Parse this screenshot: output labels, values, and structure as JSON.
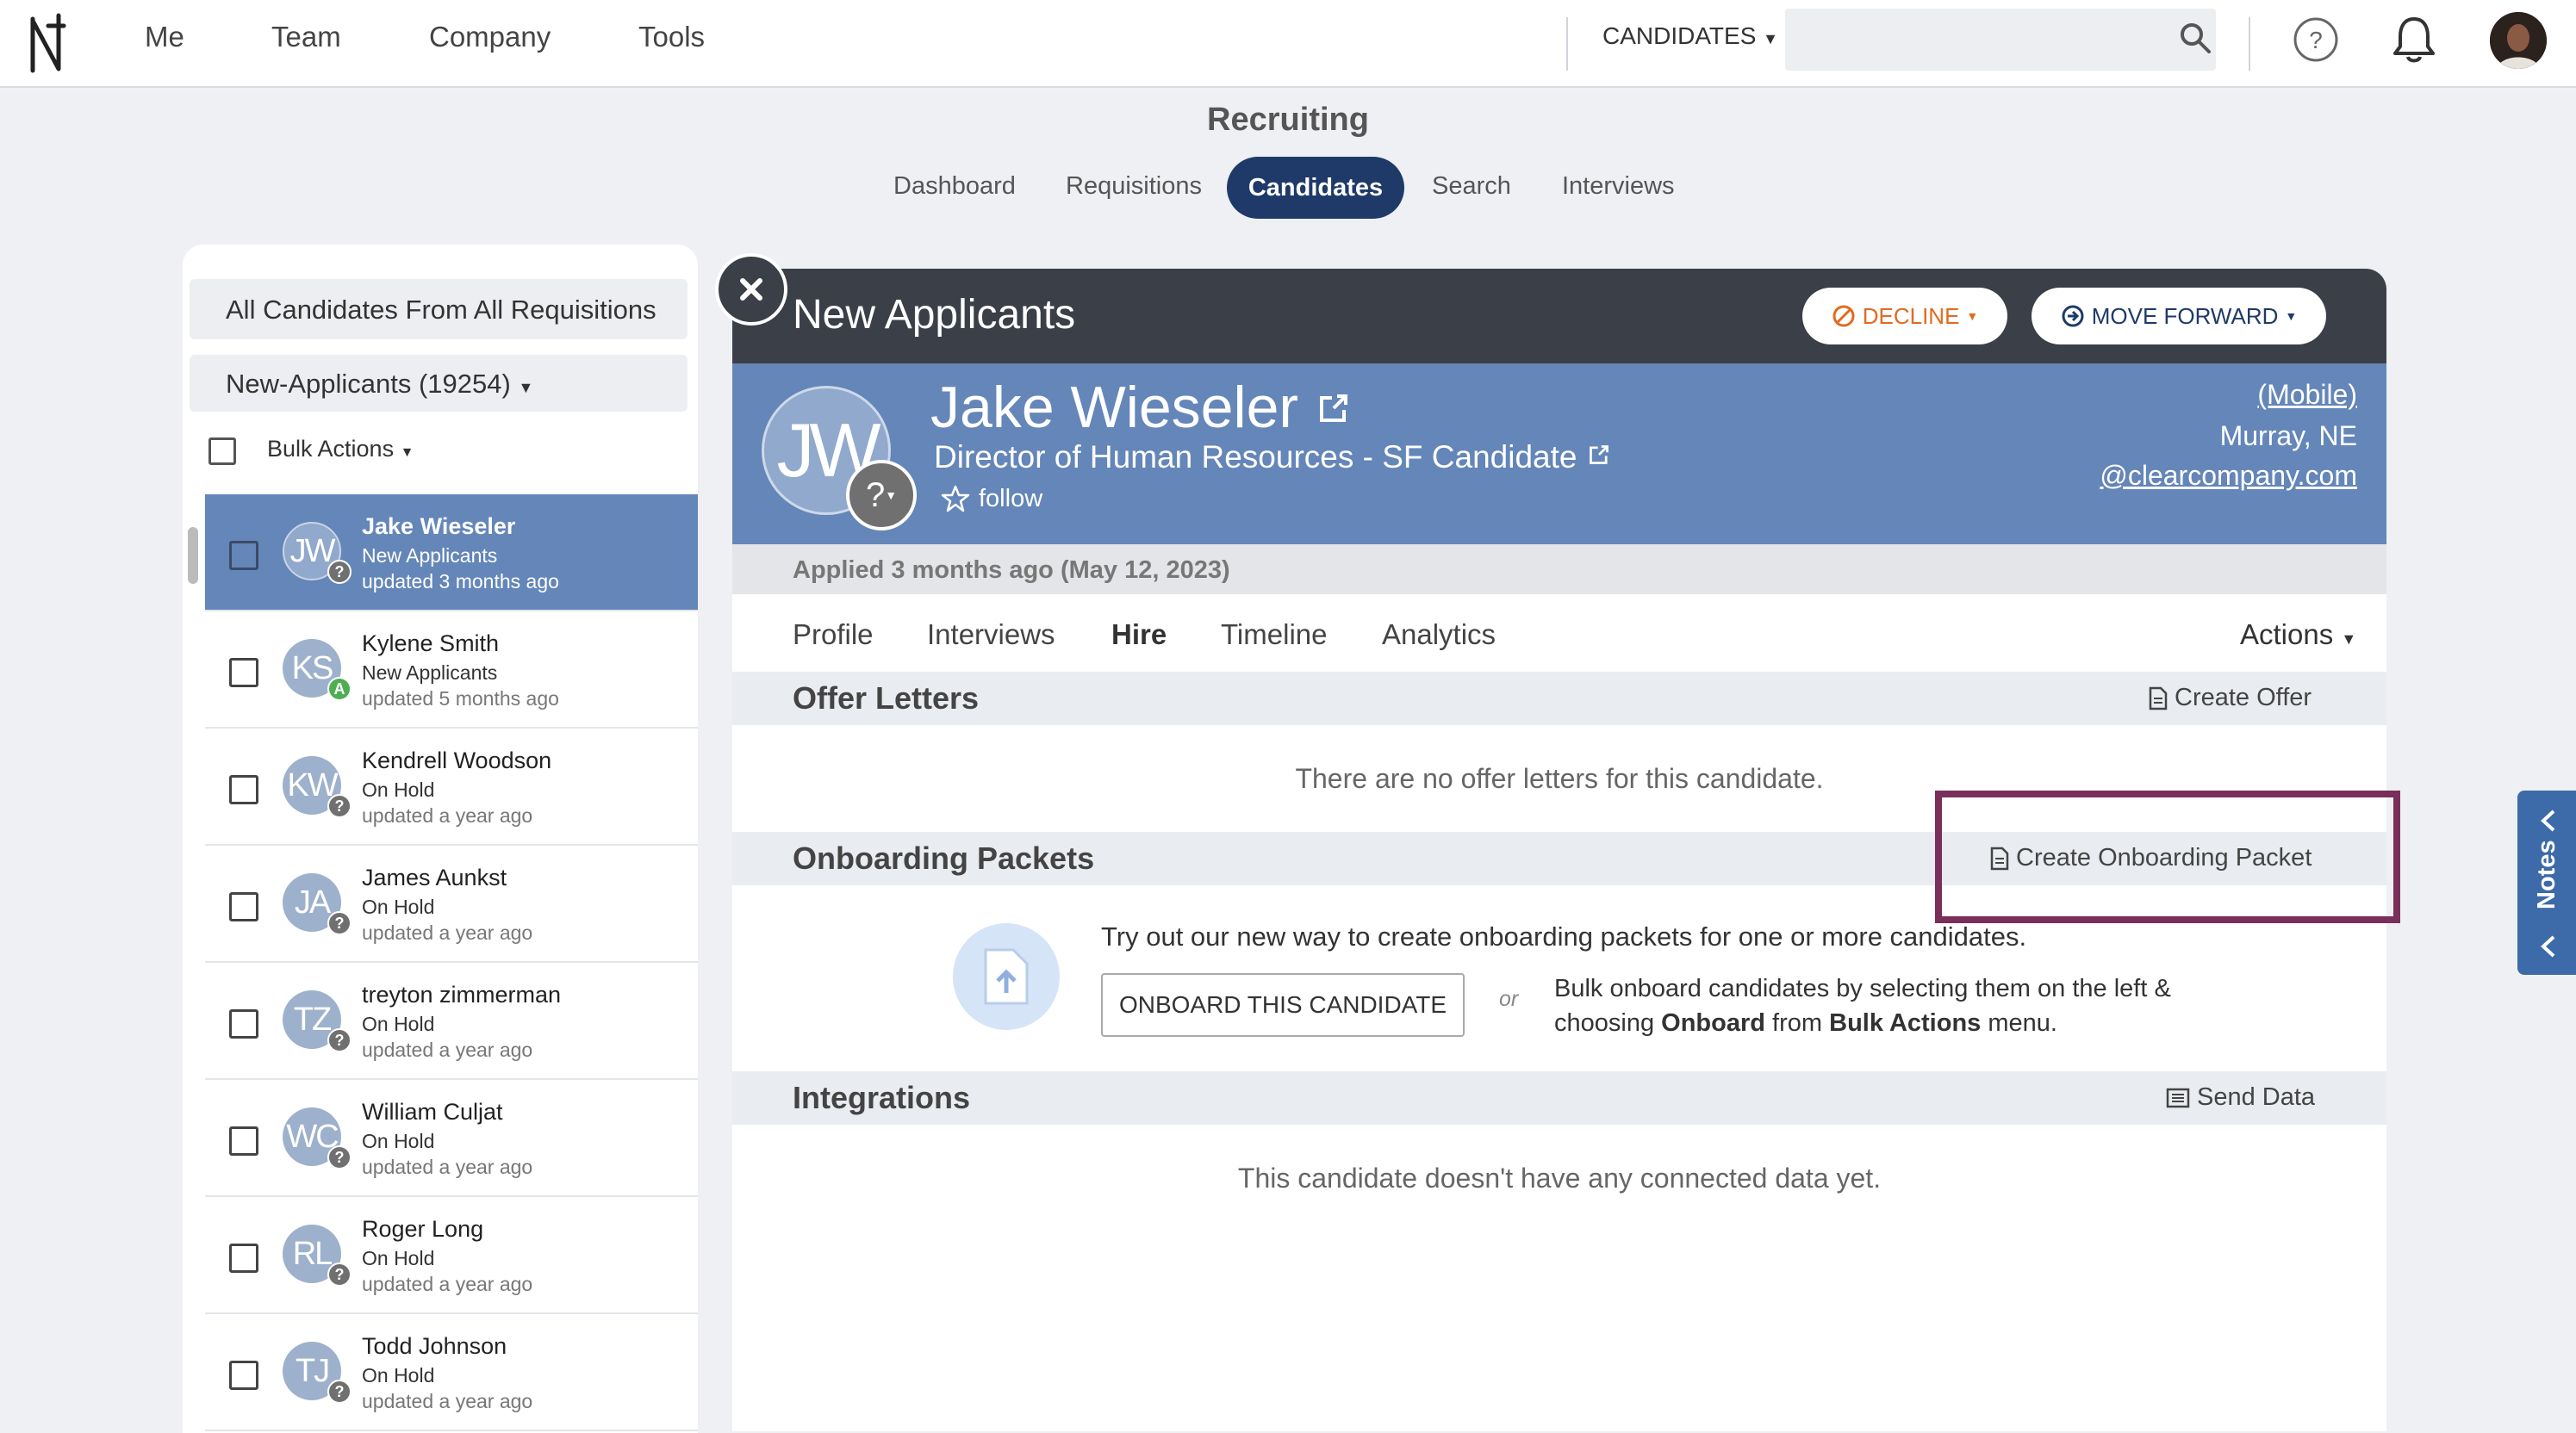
{
  "topnav": {
    "links": [
      "Me",
      "Team",
      "Company",
      "Tools"
    ],
    "search_scope": "CANDIDATES",
    "search_value": ""
  },
  "recruiting": {
    "title": "Recruiting",
    "tabs": [
      "Dashboard",
      "Requisitions",
      "Candidates",
      "Search",
      "Interviews"
    ],
    "active_tab": "Candidates"
  },
  "sidebar": {
    "filter_requisition": "All Candidates From All Requisitions",
    "filter_stage": "New-Applicants (19254)",
    "bulk_actions": "Bulk Actions",
    "candidates": [
      {
        "initials": "JW",
        "name": "Jake Wieseler",
        "status": "New Applicants",
        "updated": "updated 3 months ago",
        "badge": "?",
        "selected": true
      },
      {
        "initials": "KS",
        "name": "Kylene Smith",
        "status": "New Applicants",
        "updated": "updated 5 months ago",
        "badge": "A",
        "selected": false
      },
      {
        "initials": "KW",
        "name": "Kendrell Woodson",
        "status": "On Hold",
        "updated": "updated a year ago",
        "badge": "?",
        "selected": false
      },
      {
        "initials": "JA",
        "name": "James Aunkst",
        "status": "On Hold",
        "updated": "updated a year ago",
        "badge": "?",
        "selected": false
      },
      {
        "initials": "TZ",
        "name": "treyton zimmerman",
        "status": "On Hold",
        "updated": "updated a year ago",
        "badge": "?",
        "selected": false
      },
      {
        "initials": "WC",
        "name": "William Culjat",
        "status": "On Hold",
        "updated": "updated a year ago",
        "badge": "?",
        "selected": false
      },
      {
        "initials": "RL",
        "name": "Roger Long",
        "status": "On Hold",
        "updated": "updated a year ago",
        "badge": "?",
        "selected": false
      },
      {
        "initials": "TJ",
        "name": "Todd Johnson",
        "status": "On Hold",
        "updated": "updated a year ago",
        "badge": "?",
        "selected": false
      }
    ]
  },
  "main": {
    "stage_title": "New Applicants",
    "decline_label": "DECLINE",
    "move_forward_label": "MOVE FORWARD",
    "candidate": {
      "initials": "JW",
      "badge": "?",
      "name": "Jake Wieseler",
      "title": "Director of Human Resources - SF Candidate",
      "follow_label": "follow",
      "phone": " (Mobile)",
      "location": "Murray, NE",
      "email": "@clearcompany.com"
    },
    "applied": "Applied 3 months ago (May 12, 2023)",
    "tabs": [
      "Profile",
      "Interviews",
      "Hire",
      "Timeline",
      "Analytics"
    ],
    "active_tab": "Hire",
    "actions_label": "Actions",
    "offer_letters": {
      "title": "Offer Letters",
      "link": "Create Offer",
      "empty": "There are no offer letters for this candidate."
    },
    "onboarding": {
      "title": "Onboarding Packets",
      "link": "Create Onboarding Packet",
      "try_text": "Try out our new way to create onboarding packets for one or more candidates.",
      "button": "ONBOARD THIS CANDIDATE",
      "or": "or",
      "bulk_pre": "Bulk onboard candidates by selecting them on the left & choosing ",
      "bulk_bold1": "Onboard",
      "bulk_mid": " from ",
      "bulk_bold2": "Bulk Actions",
      "bulk_post": " menu."
    },
    "integrations": {
      "title": "Integrations",
      "link": "Send Data",
      "empty": "This candidate doesn't have any connected data yet."
    }
  },
  "notes_tab": "Notes",
  "colors": {
    "accent_navy": "#1f3a68",
    "profile_blue": "#6486b9",
    "decline_orange": "#e06b1f",
    "highlight": "#7a2e5a"
  }
}
